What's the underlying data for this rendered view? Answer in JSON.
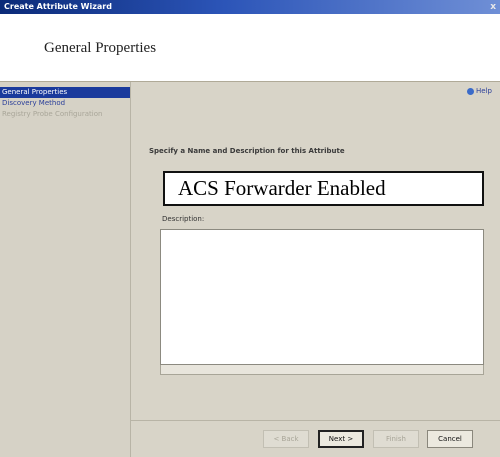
{
  "window": {
    "title": "Create Attribute Wizard",
    "close_glyph": "x"
  },
  "header": {
    "title": "General Properties"
  },
  "sidebar": {
    "items": [
      {
        "label": "General Properties",
        "state": "active"
      },
      {
        "label": "Discovery Method",
        "state": "enabled"
      },
      {
        "label": "Registry Probe Configuration",
        "state": "disabled"
      }
    ]
  },
  "help": {
    "label": "Help",
    "icon": "help-icon"
  },
  "form": {
    "instruction": "Specify a Name and Description for this Attribute",
    "name_value": "ACS Forwarder Enabled",
    "description_label": "Description:",
    "description_value": ""
  },
  "buttons": {
    "back": "< Back",
    "next": "Next >",
    "finish": "Finish",
    "cancel": "Cancel"
  },
  "colors": {
    "titlebar": "#0b2a78",
    "selection": "#1a3a9c",
    "panel": "#d8d4c8"
  }
}
